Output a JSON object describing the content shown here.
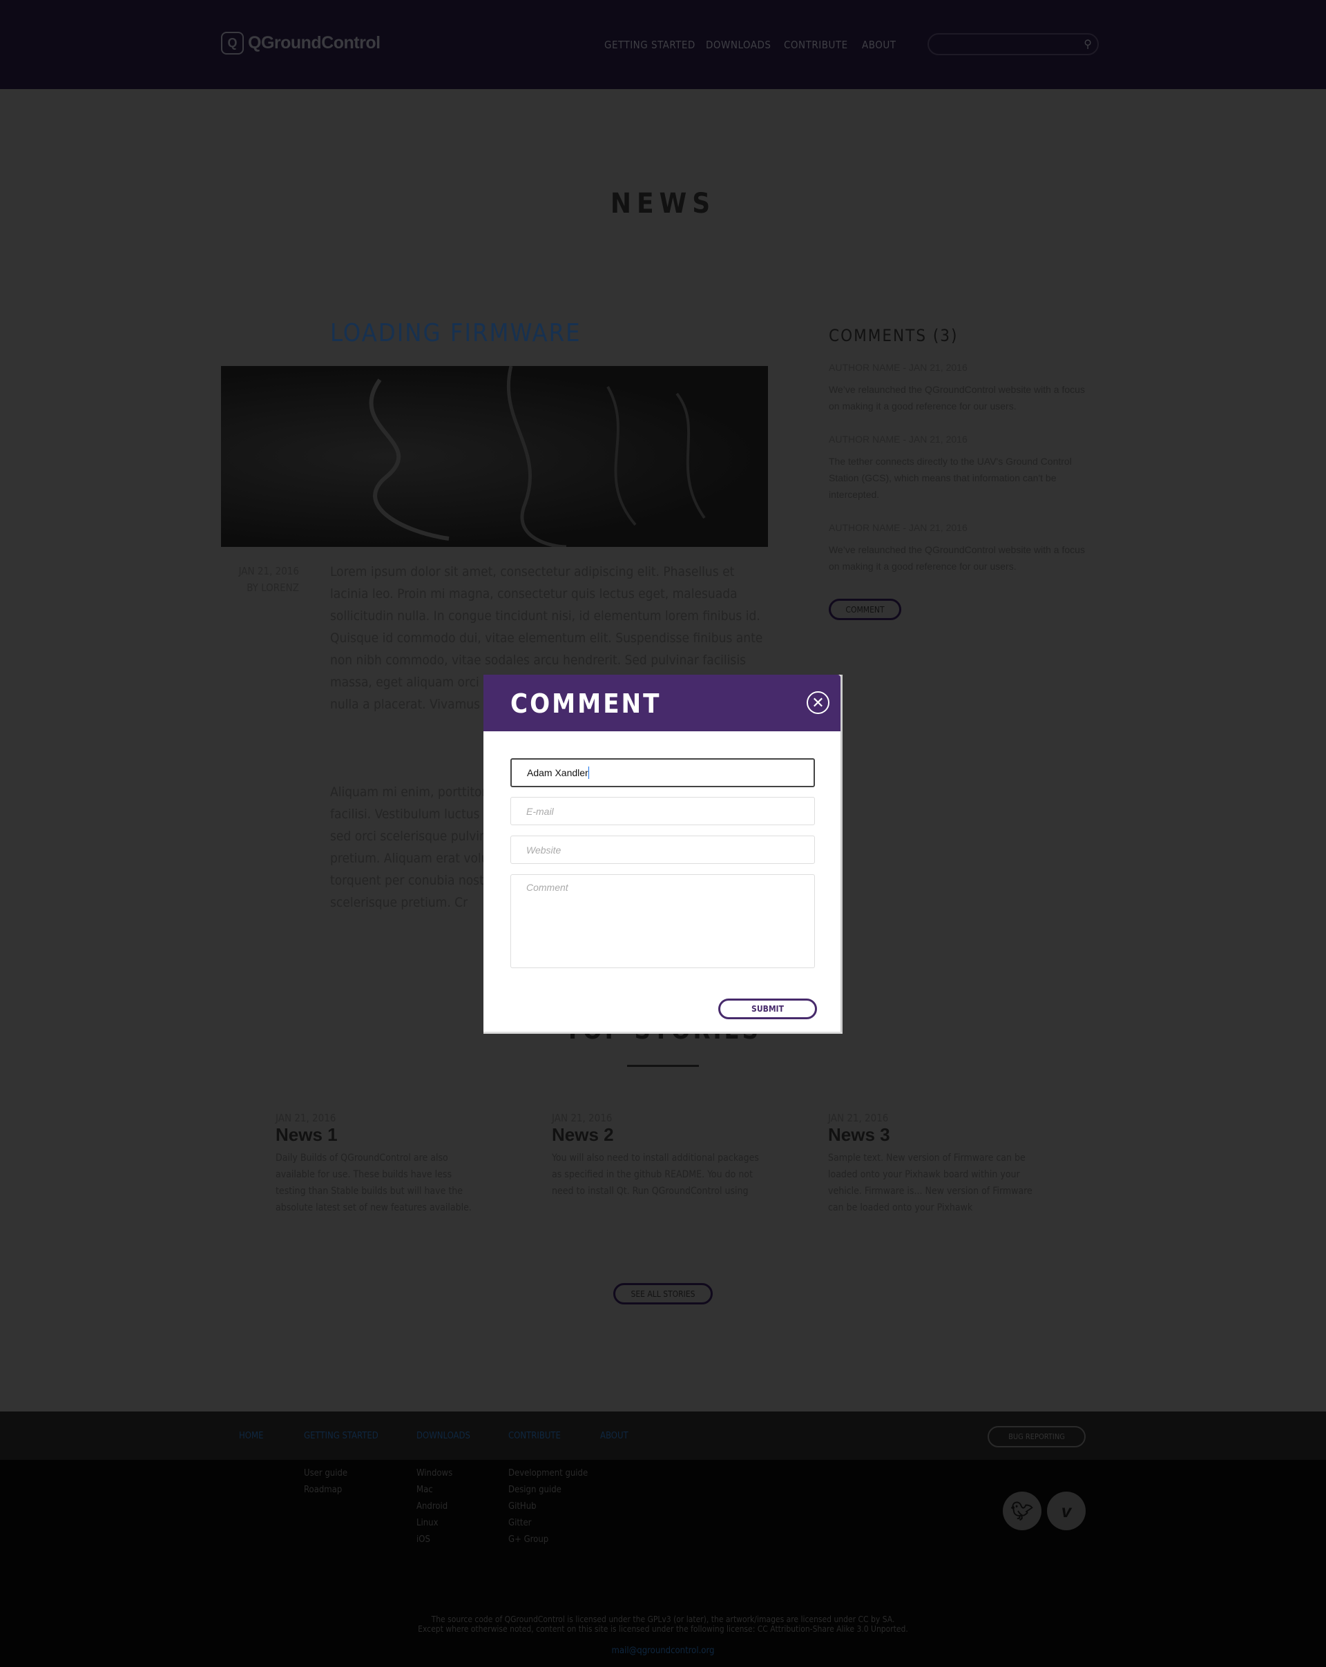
{
  "header": {
    "logo": "QGroundControl",
    "nav": [
      "GETTING STARTED",
      "DOWNLOADS",
      "CONTRIBUTE",
      "ABOUT"
    ],
    "search_placeholder": ""
  },
  "page_title": "NEWS",
  "article": {
    "title": "LOADING FIRMWARE",
    "date": "JAN 21, 2016",
    "author": "BY LORENZ",
    "paragraphs": [
      "Lorem ipsum dolor sit amet, consectetur adipiscing elit. Phasellus et lacinia leo. Proin mi magna, consectetur quis lectus eget, malesuada sollicitudin nulla. In congue tincidunt nisi, id elementum lorem finibus id. Quisque id commodo dui, vitae elementum elit. Suspendisse finibus ante non nibh commodo, vitae sodales arcu hendrerit. Sed pulvinar facilisis massa, eget aliquam orci dictum semper. Praesent ullamcorper sodales nulla a placerat. Vivamus v bibendum nibh. Ut vulputa",
      "Aliquam mi enim, porttitor facilisi. Vestibulum luctus c sed orci scelerisque pulvin pretium. Aliquam erat volu torquent per conubia nost est scelerisque pretium. Cr"
    ]
  },
  "comments": {
    "title": "COMMENTS (3)",
    "items": [
      {
        "author": "AUTHOR NAME -  JAN 21, 2016",
        "text": "We’ve relaunched the QGroundControl website with a focus on making it a good reference for our users."
      },
      {
        "author": "AUTHOR NAME -  JAN 21, 2016",
        "text": "The tether connects directly to the UAV's Ground Control Station (GCS), which means that information can't be intercepted."
      },
      {
        "author": "AUTHOR NAME -  JAN 21, 2016",
        "text": "We’ve relaunched the QGroundControl website with a focus on making it a good reference for our users."
      }
    ],
    "button": "COMMENT"
  },
  "modal": {
    "title": "COMMENT",
    "name_value": "Adam Xandler",
    "email_placeholder": "E-mail",
    "website_placeholder": "Website",
    "comment_placeholder": "Comment",
    "submit": "SUBMIT"
  },
  "top_stories": {
    "title": "TOP STORIES",
    "items": [
      {
        "date": "JAN 21, 2016",
        "title": "News 1",
        "text": "Daily Builds of QGroundControl are also available for use. These builds have less testing than Stable builds but will have the absolute latest set of new features available."
      },
      {
        "date": "JAN 21, 2016",
        "title": "News 2",
        "text": "You will also need to install additional packages as specified in the github README. You do not need to install Qt. Run QGroundControl using"
      },
      {
        "date": "JAN 21, 2016",
        "title": "News 3",
        "text": "Sample text. New version of Firmware can be loaded onto your Pixhawk board within your vehicle. Firmware is... New version of Firmware can be loaded onto your Pixhawk"
      }
    ],
    "button": "SEE ALL STORIES"
  },
  "footer": {
    "nav": [
      "HOME",
      "GETTING STARTED",
      "DOWNLOADS",
      "CONTRIBUTE",
      "ABOUT"
    ],
    "bug": "BUG REPORTING",
    "col1": [
      "User guide",
      "Roadmap"
    ],
    "col2": [
      "Windows",
      "Mac",
      "Android",
      "Linux",
      "iOS"
    ],
    "col3": [
      "Development guide",
      "Design guide",
      "GitHub",
      "Gitter",
      "G+ Group"
    ],
    "license1": "The source code of QGroundControl is licensed under the GPLv3 (or later), the artwork/images are licensed under CC by SA.",
    "license2": "Except where otherwise noted, content on this site is licensed under the following license: CC Attribution-Share Alike 3.0 Unported.",
    "mail": "mail@qgroundcontrol.org",
    "social": [
      "twitter-icon",
      "vimeo-icon"
    ]
  },
  "colors": {
    "modal_header": "#472a6b",
    "link_blue": "#173150"
  }
}
